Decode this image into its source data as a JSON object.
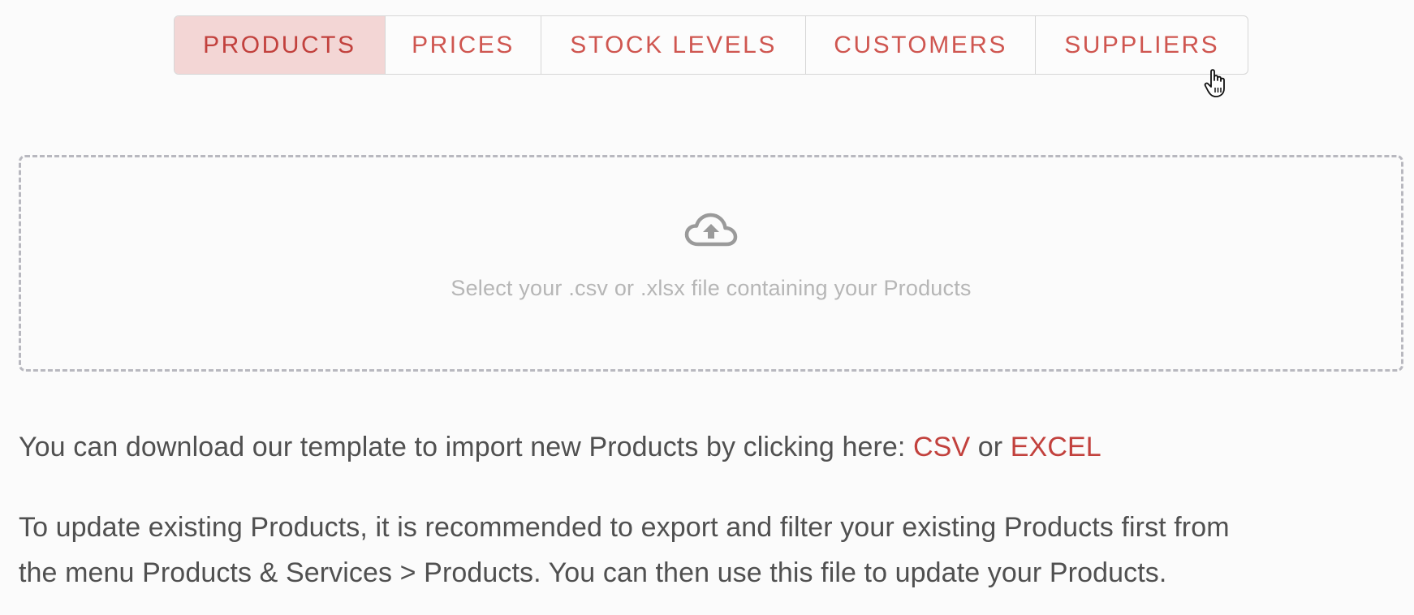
{
  "tabs": [
    {
      "label": "PRODUCTS",
      "active": true
    },
    {
      "label": "PRICES",
      "active": false
    },
    {
      "label": "STOCK LEVELS",
      "active": false
    },
    {
      "label": "CUSTOMERS",
      "active": false
    },
    {
      "label": "SUPPLIERS",
      "active": false
    }
  ],
  "dropzone": {
    "icon": "cloud-upload-icon",
    "text": "Select your .csv or .xlsx file containing your Products"
  },
  "template_line": {
    "prefix": "You can download our template to import new Products by clicking here: ",
    "csv_link": "CSV",
    "separator": " or ",
    "excel_link": "EXCEL"
  },
  "update_help": {
    "line1": "To update existing Products, it is recommended to export and filter your existing Products first from",
    "line2": "the menu Products & Services > Products. You can then use this file to update your Products."
  },
  "colors": {
    "accent": "#c2413d",
    "tab_text": "#cf5650",
    "active_tab_bg": "#f3d6d5",
    "dropzone_border": "#b8b8bf",
    "muted_text": "#b6b6b6",
    "body_text": "#505050",
    "background": "#fbfbfb"
  }
}
